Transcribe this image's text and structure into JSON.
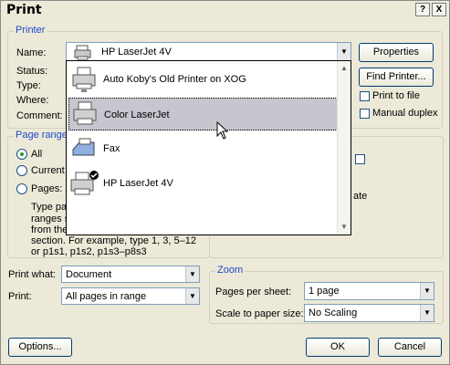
{
  "window": {
    "title": "Print",
    "help_btn": "?",
    "close_btn": "X"
  },
  "printer": {
    "legend": "Printer",
    "name_label": "Name:",
    "status_label": "Status:",
    "type_label": "Type:",
    "where_label": "Where:",
    "comment_label": "Comment:",
    "selected_name": "HP LaserJet 4V",
    "properties_btn": "Properties",
    "find_printer_btn": "Find Printer...",
    "print_to_file": "Print to file",
    "manual_duplex": "Manual duplex"
  },
  "dropdown": {
    "items": [
      {
        "label": "Auto Koby's Old Printer on XOG"
      },
      {
        "label": "Color LaserJet"
      },
      {
        "label": "Fax"
      },
      {
        "label": "HP LaserJet 4V"
      }
    ]
  },
  "page_range": {
    "legend": "Page range",
    "all": "All",
    "current": "Current",
    "pages": "Pages:",
    "help_text": [
      "Type pa",
      "ranges s",
      "from the",
      "section. For example, type 1, 3, 5–12",
      "or p1s1, p1s2, p1s3–p8s3"
    ],
    "collate_fragment": "ate"
  },
  "print_what": {
    "label": "Print what:",
    "value": "Document"
  },
  "print": {
    "label": "Print:",
    "value": "All pages in range"
  },
  "zoom": {
    "legend": "Zoom",
    "pages_per_sheet_label": "Pages per sheet:",
    "pages_per_sheet_value": "1 page",
    "scale_label": "Scale to paper size:",
    "scale_value": "No Scaling"
  },
  "buttons": {
    "options": "Options...",
    "ok": "OK",
    "cancel": "Cancel"
  },
  "colors": {
    "group_legend": "#1e4cc8",
    "selected_item": "#c6c6cf"
  }
}
